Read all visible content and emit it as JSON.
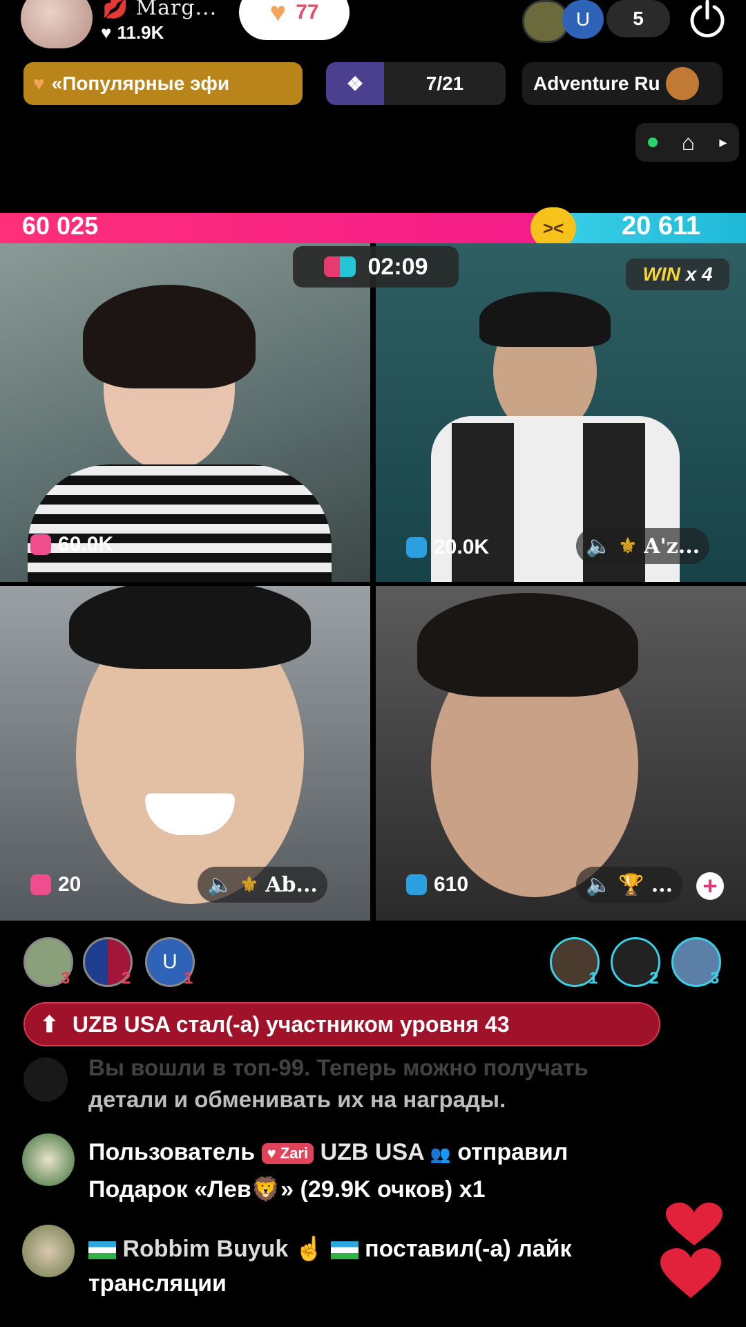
{
  "header": {
    "host_name": "Marg...",
    "host_likes": "11.9K",
    "heart_count": "77",
    "viewer_avatar_letter": "U",
    "viewer_count": "5"
  },
  "promo": {
    "popular_label": "«Популярные эфи",
    "rank": "7/21",
    "adventure_label": "Adventure Ru"
  },
  "battle": {
    "score_left": "60 025",
    "score_right": "20 611",
    "timer": "02:09",
    "win_word": "WIN",
    "win_count": "x 4"
  },
  "tiles": [
    {
      "points": "60.0K",
      "name": ""
    },
    {
      "points": "20.0K",
      "name": "A'z..."
    },
    {
      "points": "20",
      "name": "Ab..."
    },
    {
      "points": "610",
      "name": "..."
    }
  ],
  "rankings": {
    "left": [
      {
        "rank": "3"
      },
      {
        "rank": "2"
      },
      {
        "rank": "1",
        "letter": "U"
      }
    ],
    "right": [
      {
        "rank": "1"
      },
      {
        "rank": "2"
      },
      {
        "rank": "3"
      }
    ]
  },
  "chat": {
    "level_banner": "UZB USA стал(-а) участником уровня 43",
    "system_line1": "Вы вошли в топ-99. Теперь можно получать",
    "system_line2": "детали и обменивать их на награды.",
    "gift_prefix": "Пользователь",
    "gift_badge": "Zari",
    "gift_user": "UZB USA",
    "gift_verb": "отправил",
    "gift_line2_a": "Подарок «Лев",
    "gift_line2_b": "» (29.9K очков) x1",
    "like_user": "Robbim Buyuk",
    "like_text": "поставил(-а) лайк",
    "like_text2": "трансляции"
  },
  "colors": {
    "pink_team": "#f51d8a",
    "blue_team": "#1fb9d8",
    "banner_red": "#a0122a",
    "promo_gold": "#b9851a"
  }
}
